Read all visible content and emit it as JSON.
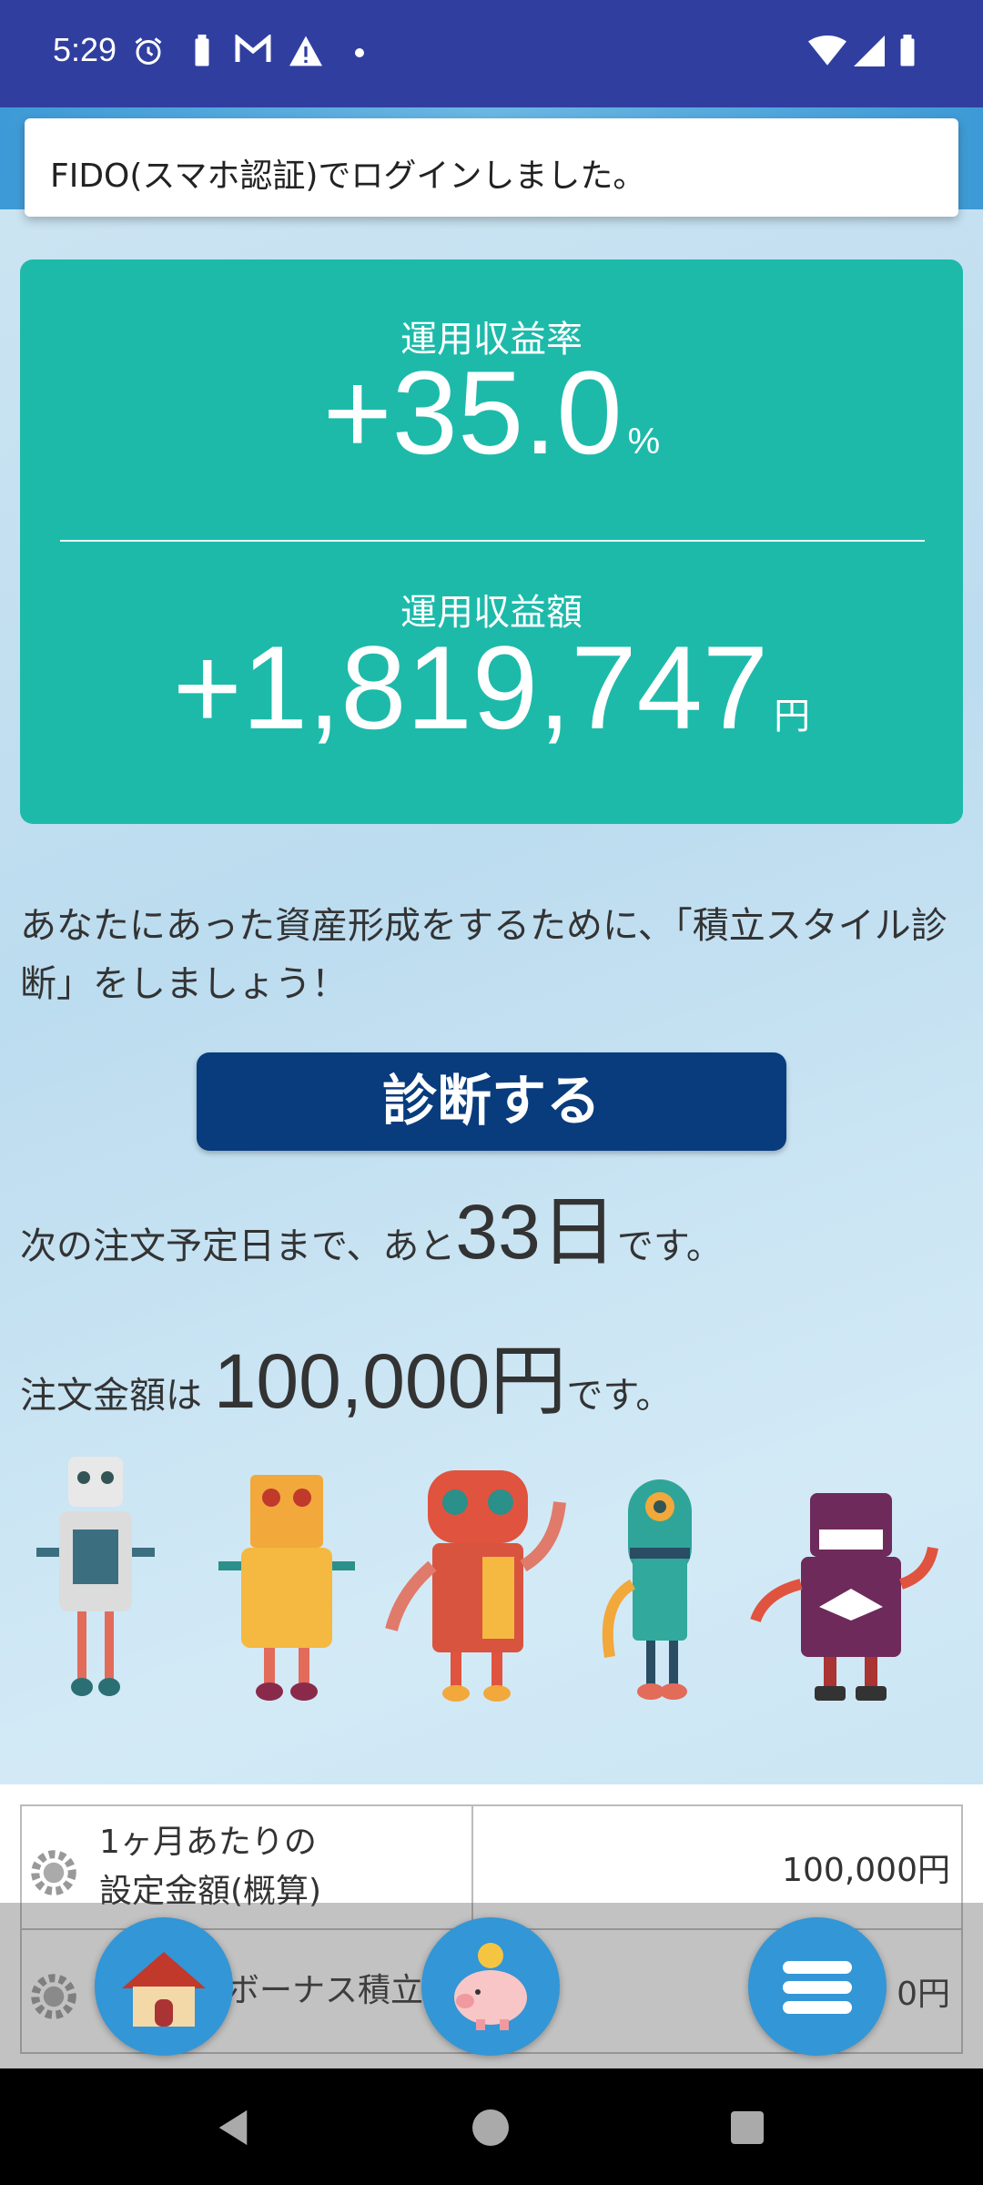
{
  "status_bar": {
    "time": "5:29",
    "icons_left": [
      "alarm-icon",
      "battery-saver-icon",
      "gmail-icon",
      "warning-icon",
      "dot-icon"
    ],
    "icons_right": [
      "wifi-icon",
      "signal-icon",
      "battery-icon"
    ]
  },
  "toast": {
    "message": "FIDO(スマホ認証)でログインしました。"
  },
  "stats": {
    "rate_label": "運用収益率",
    "rate_value": "+35.0",
    "rate_unit": "%",
    "amount_label": "運用収益額",
    "amount_value": "+1,819,747",
    "amount_unit": "円"
  },
  "intro_text": "あなたにあった資産形成をするために、「積立スタイル診断」をしましょう！",
  "diagnose_button": {
    "label": "診断する"
  },
  "next_order": {
    "prefix": "次の注文予定日まで、あと",
    "days": "33日",
    "suffix": "です。"
  },
  "order_amount": {
    "prefix": "注文金額は",
    "amount": "100,000円",
    "suffix": "です。"
  },
  "settings_table": [
    {
      "label_line1": "1ヶ月あたりの",
      "label_line2": "設定金額(概算)",
      "value": "100,000円"
    },
    {
      "label_line1": "ボーナス積立",
      "label_line2": "",
      "value": "0円"
    }
  ],
  "bottom_nav": [
    "home-icon",
    "piggy-bank-icon",
    "menu-icon"
  ],
  "colors": {
    "status_bar": "#303f9f",
    "stats_card": "#1dbaaa",
    "diagnose_button": "#083c7d",
    "fab": "#3396d6"
  }
}
